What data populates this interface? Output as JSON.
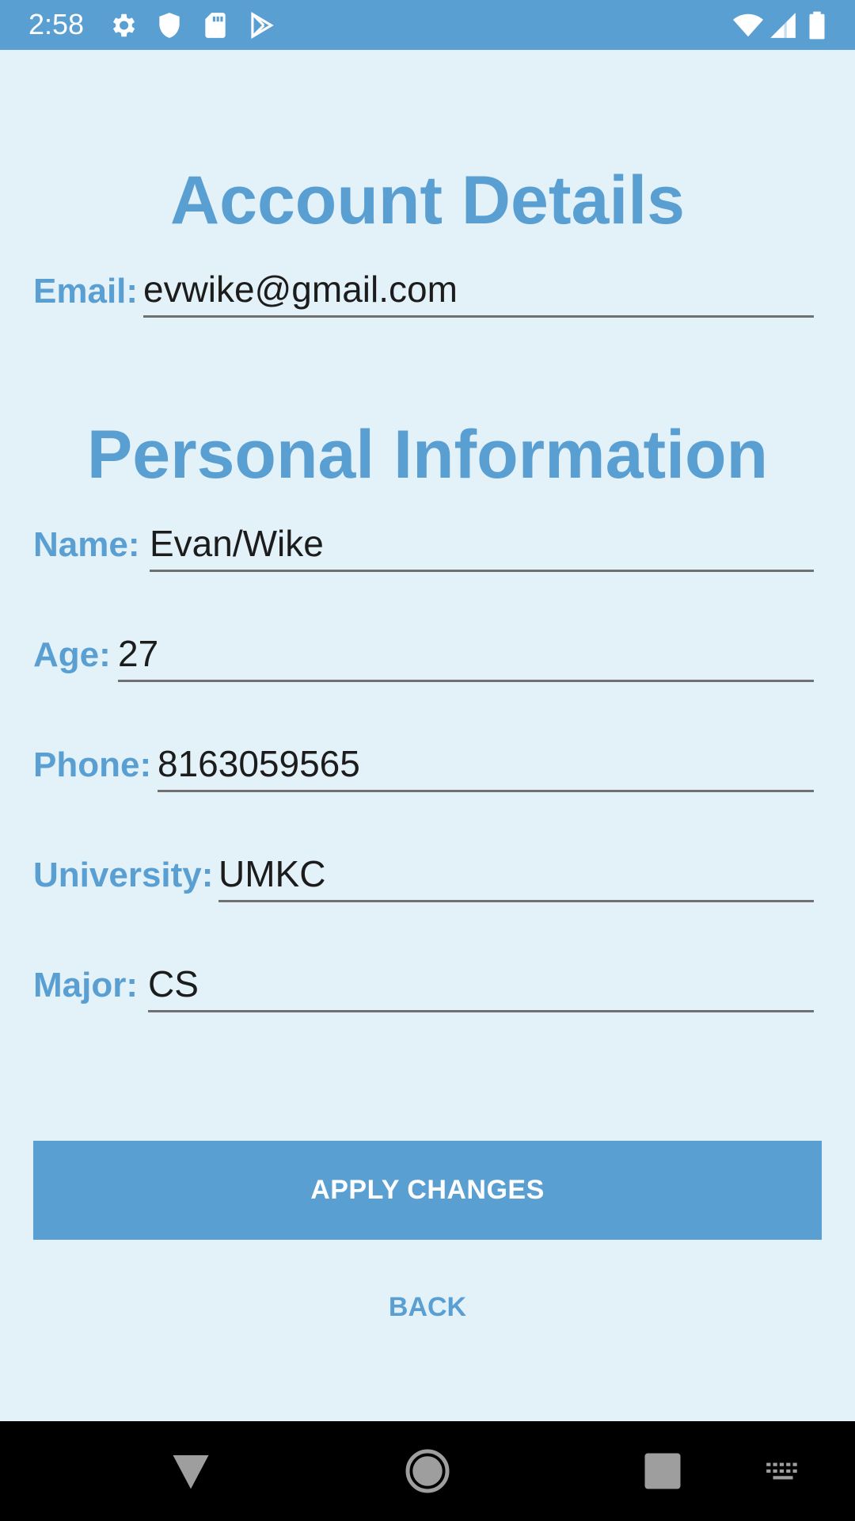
{
  "status_bar": {
    "time": "2:58",
    "icons_left": [
      "gear-icon",
      "shield-icon",
      "sd-card-icon",
      "play-store-icon"
    ],
    "icons_right": [
      "wifi-icon",
      "cell-signal-icon",
      "battery-icon"
    ]
  },
  "account_section": {
    "title": "Account Details",
    "email": {
      "label": "Email:",
      "value": "evwike@gmail.com"
    }
  },
  "personal_section": {
    "title": "Personal Information",
    "fields": {
      "name": {
        "label": "Name:",
        "value": "Evan/Wike"
      },
      "age": {
        "label": "Age:",
        "value": "27"
      },
      "phone": {
        "label": "Phone:",
        "value": "8163059565"
      },
      "university": {
        "label": "University:",
        "value": "UMKC"
      },
      "major": {
        "label": "Major:",
        "value": "CS"
      }
    }
  },
  "actions": {
    "apply_label": "APPLY CHANGES",
    "back_label": "BACK"
  },
  "nav_bar": {
    "buttons": [
      "back-triangle-icon",
      "home-circle-icon",
      "recents-square-icon",
      "keyboard-icon"
    ]
  },
  "colors": {
    "accent": "#5a9fd2",
    "background": "#e3f1f9",
    "nav_background": "#000000"
  }
}
